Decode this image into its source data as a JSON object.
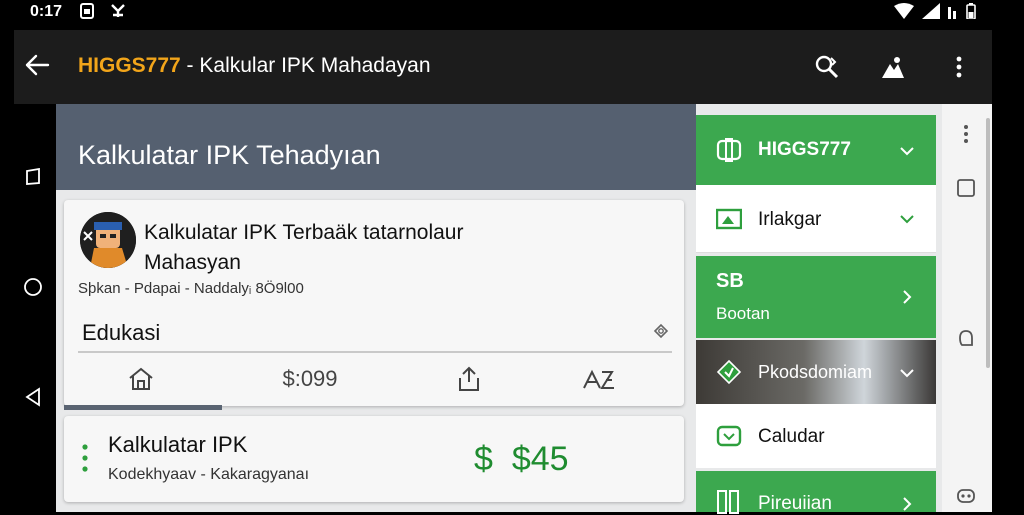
{
  "status_bar": {
    "time": "0:17",
    "left_icons": [
      "sim-card-icon",
      "app-badge-icon"
    ],
    "right_icons": [
      "wifi-icon",
      "signal-icon",
      "battery-icon"
    ]
  },
  "app_bar": {
    "brand": "HIGGS777",
    "separator": " - ",
    "title": "Kalkular IPK Mahadayan",
    "actions": [
      "search-icon",
      "share-icon",
      "more-vert-icon"
    ]
  },
  "hero": {
    "title": "Kalkulatar IPK Tehadyıan"
  },
  "card": {
    "title": "Kalkulatar IPK Terbaäk tatarnolaur Mahasyan",
    "subtitle": "Sþkan - Pdapai - Naddalyᵢ 8Ö9l00",
    "category": "Edukasi",
    "tabs": [
      {
        "icon": "home-icon",
        "label": ""
      },
      {
        "icon": "",
        "label": "$:099"
      },
      {
        "icon": "share-icon",
        "label": ""
      },
      {
        "icon": "sort-icon",
        "label": ""
      }
    ]
  },
  "list_item": {
    "title": "Kalkulatar IPK",
    "subtitle": "Kodekhyaav - Kakaragyanaı",
    "price_symbol": "$",
    "price": "$45"
  },
  "panel": {
    "items": [
      {
        "label": "HIGGS777",
        "style": "green"
      },
      {
        "label": "Irlakgar",
        "style": "white"
      },
      {
        "badge": "SB",
        "label": "Bootan",
        "style": "green"
      },
      {
        "label": "Pkodsdomiam",
        "style": "image"
      },
      {
        "label": "Caludar",
        "style": "white"
      },
      {
        "label": "Pireuiian",
        "style": "green"
      }
    ]
  },
  "colors": {
    "brand": "#f2a51a",
    "green": "#3ca84f",
    "hero": "#556070",
    "price": "#1f8c30"
  }
}
